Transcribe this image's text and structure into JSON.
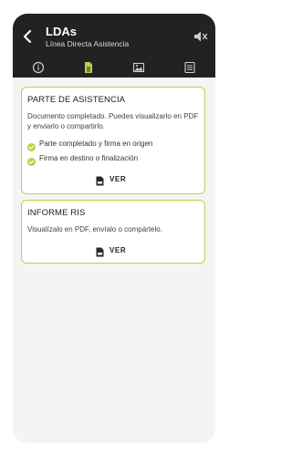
{
  "header": {
    "title": "LDAs",
    "subtitle": "Línea Directa Asistencia",
    "back_icon": "chevron-left-icon",
    "mute_icon": "volume-mute-icon",
    "background": "#222222"
  },
  "tabs": [
    {
      "icon": "info-icon",
      "active": false
    },
    {
      "icon": "document-icon",
      "active": true
    },
    {
      "icon": "image-icon",
      "active": false
    },
    {
      "icon": "list-icon",
      "active": false
    }
  ],
  "accent_color": "#b9d14a",
  "cards": {
    "parte": {
      "title": "PARTE DE ASISTENCIA",
      "description": "Documento completado. Puedes visualizarlo en PDF y enviarlo o compartirlo.",
      "checks": [
        "Parte completado y firma en origen",
        "Firma en destino o finalización"
      ],
      "button_label": "VER"
    },
    "informe": {
      "title": "INFORME RIS",
      "description": "Visualízalo en PDF, envíalo o compártelo.",
      "button_label": "VER"
    }
  }
}
